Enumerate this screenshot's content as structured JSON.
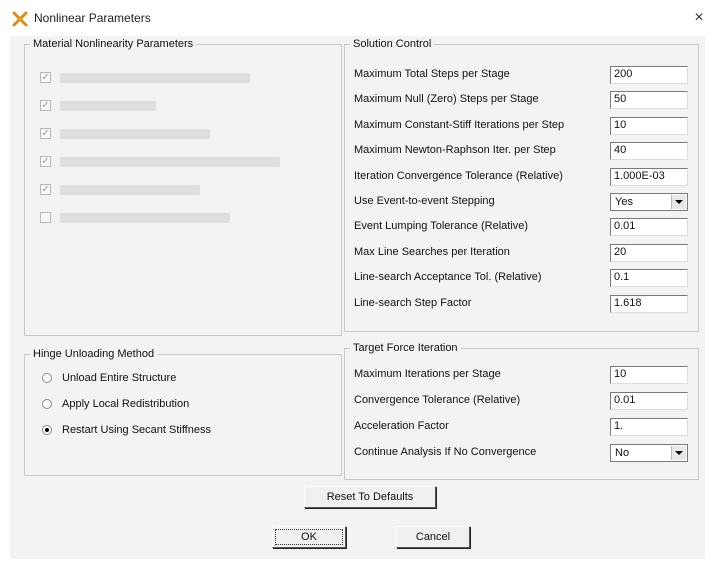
{
  "window": {
    "title": "Nonlinear Parameters",
    "close_glyph": "×",
    "icon": "sap-x-icon"
  },
  "material": {
    "title": "Material Nonlinearity Parameters",
    "checkboxes": [
      {
        "checked": true
      },
      {
        "checked": true
      },
      {
        "checked": true
      },
      {
        "checked": true
      },
      {
        "checked": true
      },
      {
        "checked": false
      }
    ]
  },
  "hinge": {
    "title": "Hinge Unloading Method",
    "options": [
      {
        "label": "Unload Entire Structure",
        "selected": false
      },
      {
        "label": "Apply Local Redistribution",
        "selected": false
      },
      {
        "label": "Restart Using Secant Stiffness",
        "selected": true
      }
    ]
  },
  "solution": {
    "title": "Solution Control",
    "rows": [
      {
        "label": "Maximum Total Steps per Stage",
        "value": "200"
      },
      {
        "label": "Maximum Null (Zero) Steps per Stage",
        "value": "50"
      },
      {
        "label": "Maximum Constant-Stiff Iterations per Step",
        "value": "10"
      },
      {
        "label": "Maximum Newton-Raphson Iter. per Step",
        "value": "40"
      },
      {
        "label": "Iteration Convergence Tolerance (Relative)",
        "value": "1.000E-03"
      },
      {
        "label": "Use Event-to-event Stepping",
        "value": "Yes"
      },
      {
        "label": "Event Lumping Tolerance (Relative)",
        "value": "0.01"
      },
      {
        "label": "Max Line Searches per Iteration",
        "value": "20"
      },
      {
        "label": "Line-search Acceptance Tol. (Relative)",
        "value": "0.1"
      },
      {
        "label": "Line-search Step Factor",
        "value": "1.618"
      }
    ]
  },
  "target": {
    "title": "Target Force Iteration",
    "rows": [
      {
        "label": "Maximum Iterations per Stage",
        "value": "10"
      },
      {
        "label": "Convergence Tolerance (Relative)",
        "value": "0.01"
      },
      {
        "label": "Acceleration Factor",
        "value": "1."
      },
      {
        "label": "Continue Analysis If No Convergence",
        "value": "No"
      }
    ]
  },
  "buttons": {
    "reset": "Reset To Defaults",
    "ok": "OK",
    "cancel": "Cancel"
  }
}
